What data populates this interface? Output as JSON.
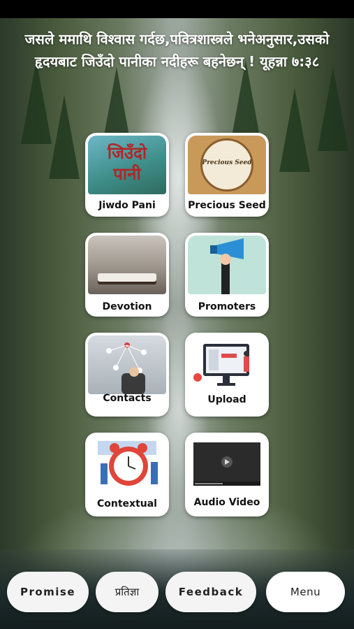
{
  "header": {
    "verse": "जसले ममाथि विश्वास गर्दछ,पवित्रशास्त्रले भनेअनुसार,उसको हृदयबाट जिउँदो पानीका नदीहरू बहनेछन् ! यूहन्ना ७:३८"
  },
  "tiles": [
    {
      "label": "Jiwdo Pani",
      "thumb_text": "जिउँदो पानी"
    },
    {
      "label": "Precious Seed",
      "thumb_text": "Precious Seed"
    },
    {
      "label": "Devotion"
    },
    {
      "label": "Promoters"
    },
    {
      "label": "Contacts"
    },
    {
      "label": "Upload"
    },
    {
      "label": "Contextual"
    },
    {
      "label": "Audio Video"
    }
  ],
  "bottom_bar": {
    "promise": "Promise",
    "pratigya": "प्रतिज्ञा",
    "feedback": "Feedback",
    "menu": "Menu"
  },
  "colors": {
    "tile_bg": "#ffffff",
    "button_bg": "#f4f4f4",
    "promoter_bg": "#bfe3d9",
    "megaphone": "#2b8fd6",
    "clock": "#e0453a"
  }
}
